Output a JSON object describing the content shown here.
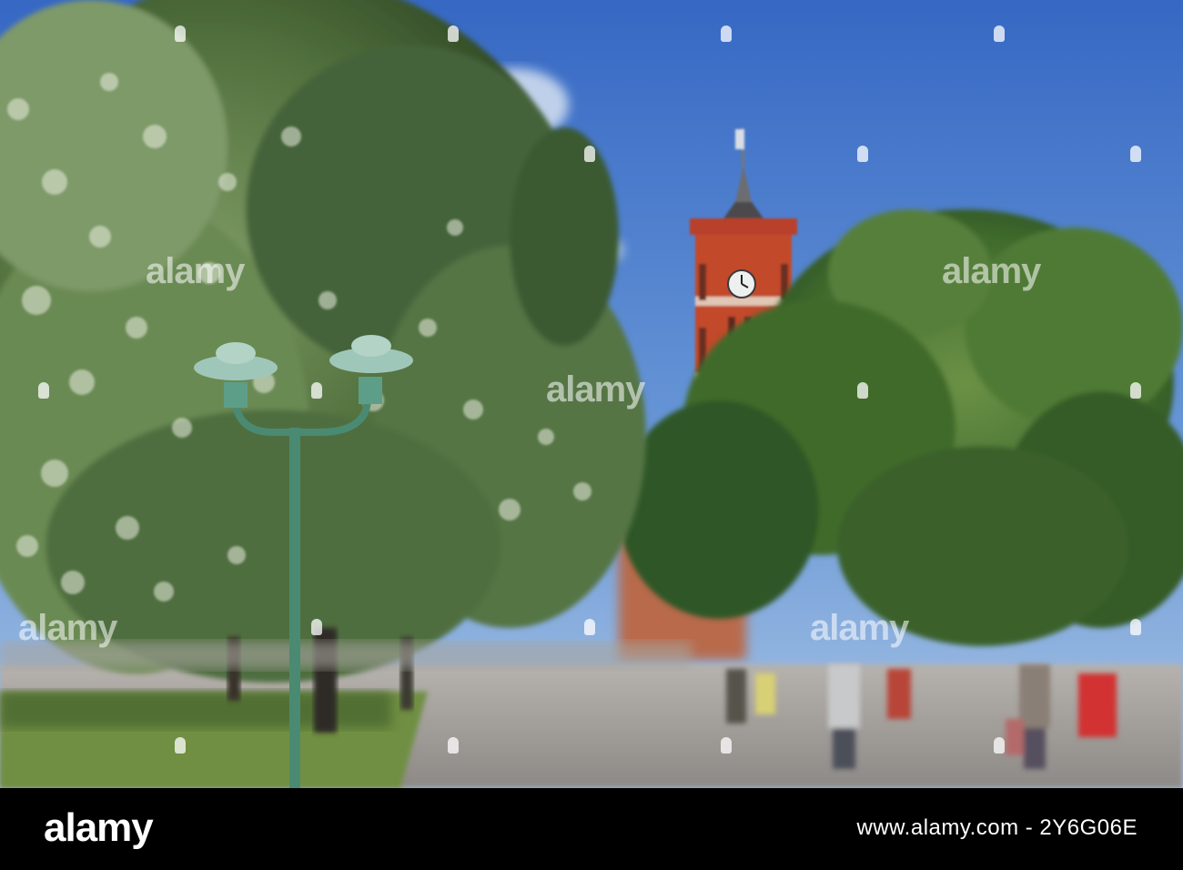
{
  "photo": {
    "watermark_text": "alamy",
    "watermark_image_id_text": "alamy"
  },
  "footer": {
    "logo_text": "alamy",
    "image_id": "www.alamy.com - 2Y6G06E"
  },
  "colors": {
    "sky_top": "#3c72c8",
    "sky_bottom": "#8bb2e0",
    "tower_brick": "#c2452a",
    "foliage_dark": "#2f4a22",
    "foliage_light": "#6e8f4a",
    "lamp_green": "#4f8a76",
    "path_grey": "#9a9795",
    "footer_bg": "#000000"
  }
}
